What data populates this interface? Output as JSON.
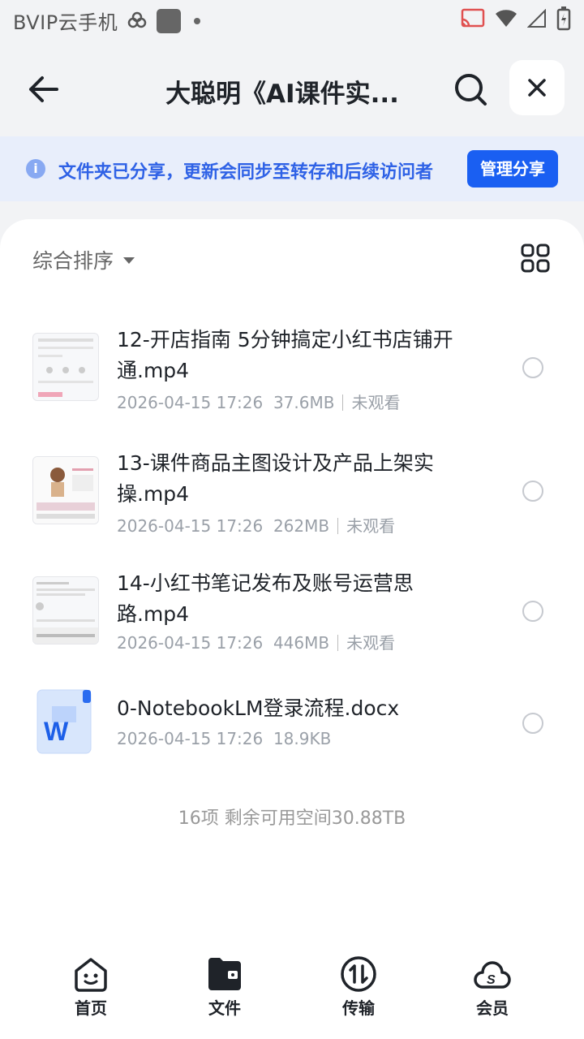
{
  "status_bar": {
    "app_name": "BVIP云手机"
  },
  "header": {
    "title": "大聪明《AI课件实..."
  },
  "banner": {
    "text": "文件夹已分享，更新会同步至转存和后续访问者",
    "button": "管理分享"
  },
  "toolbar": {
    "sort_label": "综合排序"
  },
  "files": [
    {
      "name": "12-开店指南 5分钟搞定小红书店铺开通.mp4",
      "date": "2026-04-15 17:26",
      "size": "37.6MB",
      "status": "未观看"
    },
    {
      "name": "13-课件商品主图设计及产品上架实操.mp4",
      "date": "2026-04-15 17:26",
      "size": "262MB",
      "status": "未观看"
    },
    {
      "name": "14-小红书笔记发布及账号运营思路.mp4",
      "date": "2026-04-15 17:26",
      "size": "446MB",
      "status": "未观看"
    },
    {
      "name": "0-NotebookLM登录流程.docx",
      "date": "2026-04-15 17:26",
      "size": "18.9KB"
    }
  ],
  "footer": {
    "summary": "16项 剩余可用空间30.88TB"
  },
  "nav": {
    "home": "首页",
    "files": "文件",
    "transfer": "传输",
    "member": "会员"
  },
  "colors": {
    "accent": "#1a5ff2",
    "banner_bg": "#e8eefb",
    "banner_text": "#2f62e6"
  }
}
